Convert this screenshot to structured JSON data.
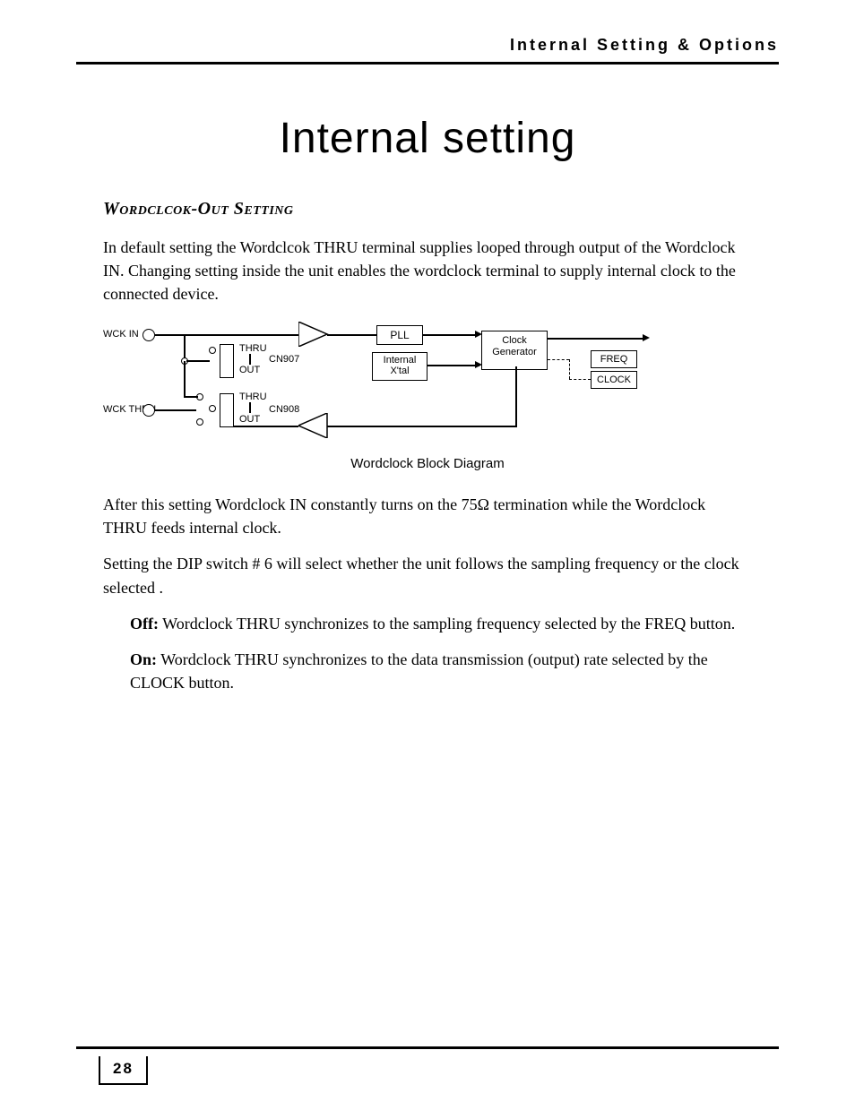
{
  "header": {
    "running_title": "Internal Setting & Options"
  },
  "title": "Internal setting",
  "section": {
    "heading": "Wordclcok-Out Setting",
    "para1": "In default setting the Wordclcok THRU terminal supplies looped through output of the Wordclock IN. Changing setting inside the unit enables the wordclock terminal to supply internal clock to the connected device.",
    "diagram": {
      "caption": "Wordclock Block Diagram",
      "labels": {
        "wck_in": "WCK IN",
        "wck_thru": "WCK THRU",
        "thru": "THRU",
        "out": "OUT",
        "cn907": "CN907",
        "cn908": "CN908",
        "pll": "PLL",
        "xtal": "Internal X'tal",
        "clockgen": "Clock Generator",
        "freq": "FREQ",
        "clock": "CLOCK"
      }
    },
    "para2": "After this setting  Wordclock IN constantly turns on the 75Ω termination while the Wordclock THRU feeds internal clock.",
    "para3": "Setting the DIP switch # 6 will select whether the unit follows the sampling frequency or the clock selected .",
    "off_label": "Off:",
    "off_text": " Wordclock THRU synchronizes to the sampling frequency selected by the FREQ button.",
    "on_label": "On:",
    "on_text": " Wordclock THRU synchronizes to the data transmission (output) rate selected by the CLOCK button."
  },
  "page_number": "28"
}
